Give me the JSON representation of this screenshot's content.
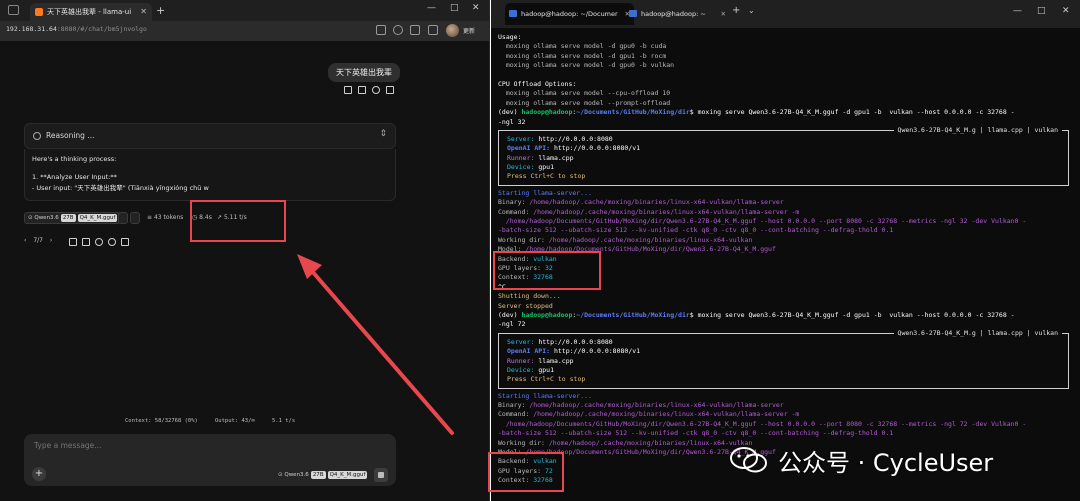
{
  "browser": {
    "tab_title": "天下英雄出我辈 - llama-ui",
    "url_host": "192.168.31.64",
    "url_rest": ":8080/#/chat/bm5jnvolgo",
    "update_label": "更新",
    "window_controls": [
      "—",
      "□",
      "✕"
    ]
  },
  "chat": {
    "user_message": "天下英雄出我辈",
    "reasoning_title": "Reasoning ...",
    "reasoning_lines": [
      "Here's a thinking process:",
      "1.  **Analyze User Input:**",
      "    - User input: \"天下英雄出我辈\" (Tiānxià yīngxióng chū w"
    ],
    "stats": {
      "model_name": "Qwen3.6",
      "model_size": "27B",
      "model_quant": "Q4_K_M.gguf",
      "tokens": "43 tokens",
      "time": "8.4s",
      "speed": "5.11 t/s"
    },
    "pager": "7/7",
    "status": {
      "context": "Context: 58/32768 (0%)",
      "output": "Output: 43/∞",
      "speed": "5.1 t/s"
    },
    "composer_placeholder": "Type a message...",
    "composer_model": "Qwen3.6",
    "composer_size": "27B",
    "composer_quant": "Q4_K_M.gguf"
  },
  "terminal": {
    "tabs": [
      "hadoop@hadoop: ~/Documer",
      "hadoop@hadoop: ~"
    ],
    "lines_top": [
      "Usage:",
      "  moxing ollama serve model -d gpu0 -b cuda",
      "  moxing ollama serve model -d gpu1 -b rocm",
      "  moxing ollama serve model -d gpu0 -b vulkan",
      "",
      "CPU Offload Options:",
      "  moxing ollama serve model --cpu-offload 10",
      "  moxing ollama serve model --prompt-offload"
    ],
    "prompt_env": "(dev) ",
    "prompt_user": "hadoop@hadoop",
    "prompt_path": "~/Documents/GitHub/MoXing/dir",
    "cmd1": "$ moxing serve Qwen3.6-27B-Q4_K_M.gguf -d gpu1 -b  vulkan --host 0.0.0.0 -c 32768 -",
    "cmd1_cont": "-ngl 32",
    "cmd2": "$ moxing serve Qwen3.6-27B-Q4_K_M.gguf -d gpu1 -b  vulkan --host 0.0.0.0 -c 32768 -",
    "cmd2_cont": "-ngl 72",
    "panel_title": "Qwen3.6-27B-Q4_K_M.g | llama.cpp | vulkan",
    "panel": {
      "server_label": "Server:",
      "server": "http://0.0.0.0:8080",
      "openai_label": "OpenAI API:",
      "openai": "http://0.0.0.0:8080/v1",
      "runner_label": "Runner:",
      "runner": "llama.cpp",
      "device_label": "Device:",
      "device": "gpu1",
      "stop": "Press Ctrl+C to stop"
    },
    "starting": "Starting llama-server...",
    "binary_label": "Binary: ",
    "binary": "/home/hadoop/.cache/moxing/binaries/linux-x64-vulkan/llama-server",
    "command_label": "Command: ",
    "command": "/home/hadoop/.cache/moxing/binaries/linux-x64-vulkan/llama-server -m",
    "cmd_line_a": "  /home/hadoop/Documents/GitHub/MoXing/dir/Qwen3.6-27B-Q4_K_M.gguf --host 0.0.0.0 --port 8080 -c 32768 --metrics -ngl 32 -dev Vulkan0 -",
    "cmd_line_b": "-batch-size 512 --ubatch-size 512 --kv-unified -ctk q8_0 -ctv q8_0 --cont-batching --defrag-thold 0.1",
    "cmd_line_a2": "  /home/hadoop/Documents/GitHub/MoXing/dir/Qwen3.6-27B-Q4_K_M.gguf --host 0.0.0.0 --port 8080 -c 32768 --metrics -ngl 72 -dev Vulkan0 -",
    "workdir_label": "Working dir: ",
    "workdir": "/home/hadoop/.cache/moxing/binaries/linux-x64-vulkan",
    "model_label": "Model: ",
    "model": "/home/hadoop/Documents/GitHub/MoXing/dir/Qwen3.6-27B-Q4_K_M.gguf",
    "backend_label": "Backend: ",
    "backend": "vulkan",
    "gpu_layers_label": "GPU layers: ",
    "gpu_layers_1": "32",
    "gpu_layers_2": "72",
    "context_label": "Context: ",
    "context": "32768",
    "ctrl_c": "^C",
    "shutting": "Shutting down...",
    "stopped": "Server stopped"
  },
  "watermark": "公众号 · CycleUser",
  "colors": {
    "annotation_red": "#e8474e",
    "prompt_green": "#13c26b",
    "prompt_blue": "#5c7cfa"
  }
}
